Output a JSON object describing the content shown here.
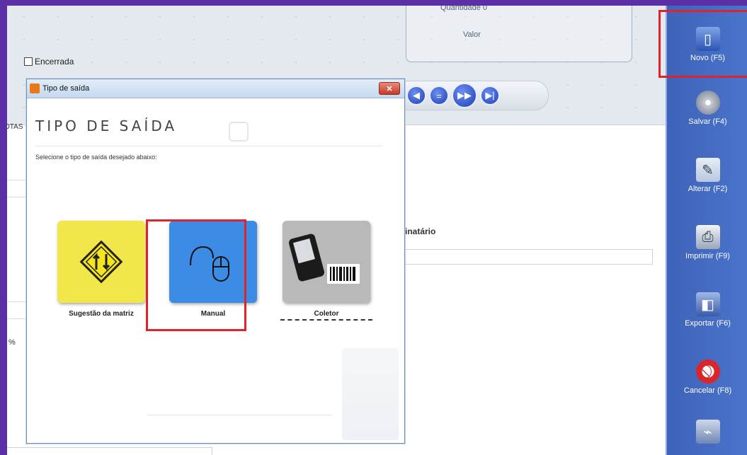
{
  "header": {
    "quantidade_label": "Quantidade 0",
    "valor_label": "Valor",
    "encerrada_label": "Encerrada"
  },
  "background": {
    "otas_tab": "OTAS",
    "destinatario_label": "tinatário",
    "pct_symbol": "%"
  },
  "toolbar": [
    {
      "label": "Novo (F5)",
      "icon": "new-document-icon"
    },
    {
      "label": "Salvar (F4)",
      "icon": "disc-save-icon"
    },
    {
      "label": "Alterar (F2)",
      "icon": "edit-page-icon"
    },
    {
      "label": "Imprimir (F9)",
      "icon": "printer-icon"
    },
    {
      "label": "Exportar (F6)",
      "icon": "export-icon"
    },
    {
      "label": "Cancelar (F8)",
      "icon": "cancel-icon"
    },
    {
      "label": "",
      "icon": "broom-icon"
    }
  ],
  "dialog": {
    "title": "Tipo de saída",
    "close_label": "✕",
    "heading": "TIPO DE SAÍDA",
    "subtitle": "Selecione o tipo de saída desejado abaixo:",
    "options": [
      {
        "label": "Sugestão da matriz",
        "icon": "arrows-sign-icon",
        "color": "#f1e64a"
      },
      {
        "label": "Manual",
        "icon": "mouse-icon",
        "color": "#3c8ce6"
      },
      {
        "label": "Coletor",
        "icon": "handheld-scanner-icon",
        "color": "#b9b9b9"
      }
    ]
  },
  "colors": {
    "accent": "#e0222a",
    "toolbar": "#4a74cc"
  }
}
